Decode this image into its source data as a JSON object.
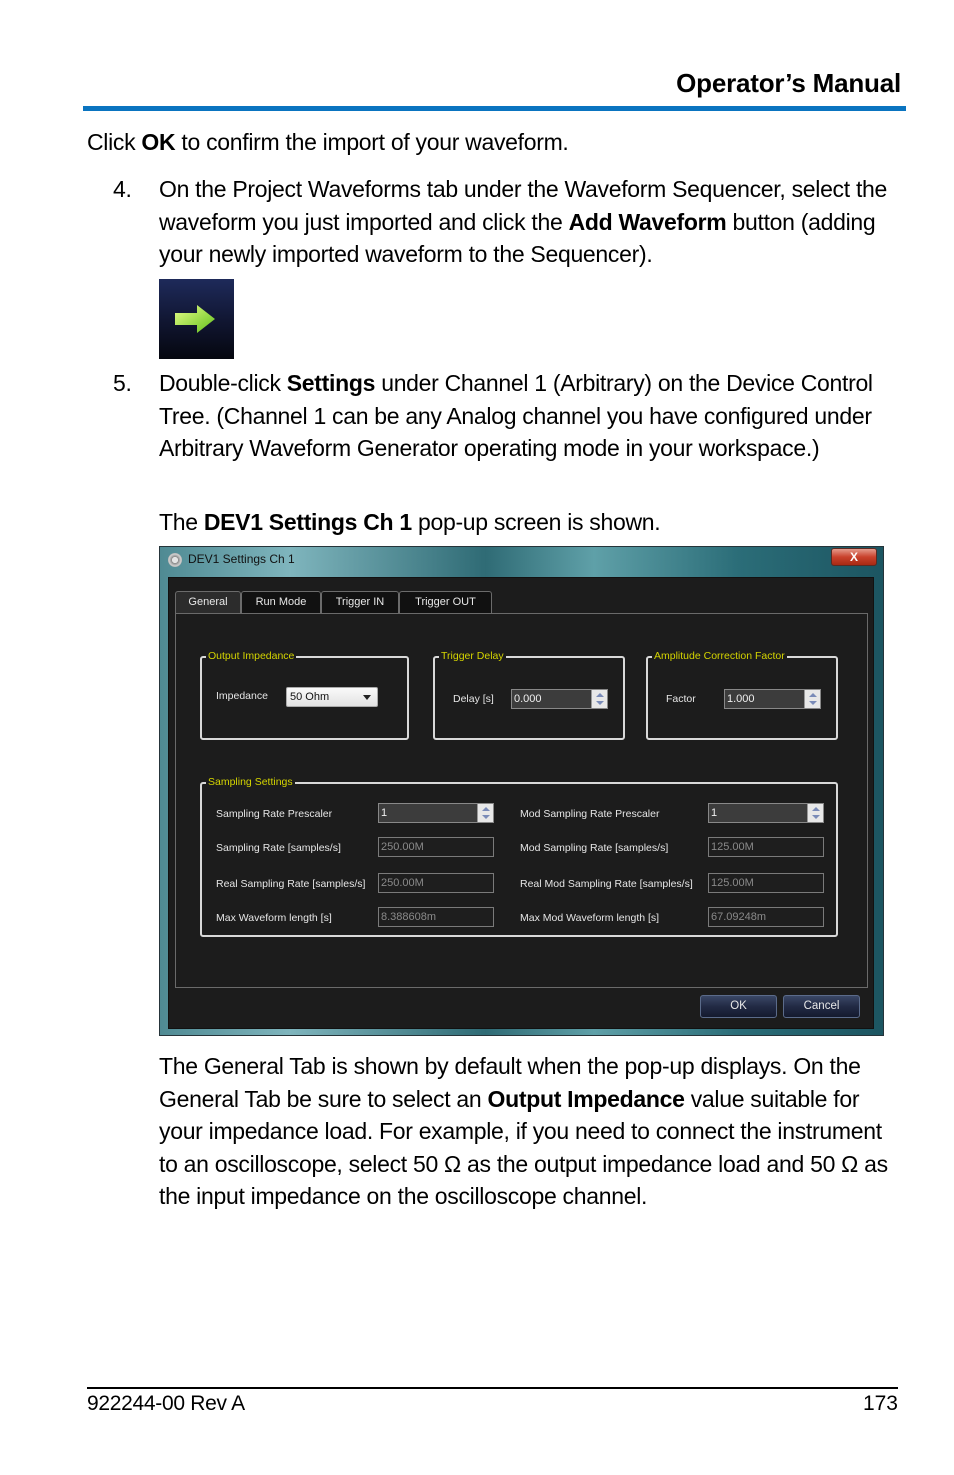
{
  "header": {
    "title": "Operator’s Manual",
    "accent_color": "#0a74c0"
  },
  "intro": {
    "pre": "Click ",
    "bold": "OK",
    "post": " to confirm the import of your waveform."
  },
  "steps": [
    {
      "number": "4.",
      "parts": [
        {
          "text": "On the Project Waveforms tab under the Waveform Sequencer, select the waveform you just imported and click the "
        },
        {
          "bold": "Add Waveform"
        },
        {
          "text": " button (adding your newly imported waveform to the Sequencer)."
        }
      ],
      "image_icon": "green-right-arrow-icon"
    },
    {
      "number": "5.",
      "parts": [
        {
          "text": "Double-click "
        },
        {
          "bold": "Settings"
        },
        {
          "text": " under Channel 1 (Arbitrary) on the Device Control Tree. (Channel 1 can be any Analog channel you have configured under Arbitrary Waveform Generator operating mode in your workspace.)"
        }
      ]
    }
  ],
  "popup_intro": {
    "pre": "The ",
    "bold": "DEV1 Settings Ch 1",
    "post": " pop-up screen is shown."
  },
  "dialog": {
    "title": "DEV1 Settings Ch 1",
    "close_label": "X",
    "tabs": [
      {
        "label": "General",
        "active": true
      },
      {
        "label": "Run Mode",
        "active": false
      },
      {
        "label": "Trigger IN",
        "active": false
      },
      {
        "label": "Trigger OUT",
        "active": false
      }
    ],
    "output_impedance": {
      "group_label": "Output Impedance",
      "field_label": "Impedance",
      "selected": "50 Ohm"
    },
    "trigger_delay": {
      "group_label": "Trigger Delay",
      "field_label": "Delay [s]",
      "value": "0.000"
    },
    "amplitude_correction": {
      "group_label": "Amplitude Correction Factor",
      "field_label": "Factor",
      "value": "1.000"
    },
    "sampling": {
      "group_label": "Sampling Settings",
      "left": [
        {
          "label": "Sampling Rate Prescaler",
          "value": "1",
          "type": "spin"
        },
        {
          "label": "Sampling Rate [samples/s]",
          "value": "250.00M",
          "type": "readonly"
        },
        {
          "label": "Real Sampling Rate [samples/s]",
          "value": "250.00M",
          "type": "readonly"
        },
        {
          "label": "Max Waveform length [s]",
          "value": "8.388608m",
          "type": "readonly"
        }
      ],
      "right": [
        {
          "label": "Mod Sampling Rate Prescaler",
          "value": "1",
          "type": "spin"
        },
        {
          "label": "Mod Sampling Rate [samples/s]",
          "value": "125.00M",
          "type": "readonly"
        },
        {
          "label": "Real Mod Sampling Rate [samples/s]",
          "value": "125.00M",
          "type": "readonly"
        },
        {
          "label": "Max Mod Waveform length [s]",
          "value": "67.09248m",
          "type": "readonly"
        }
      ]
    },
    "ok_label": "OK",
    "cancel_label": "Cancel"
  },
  "general_paragraph": {
    "parts": [
      {
        "text": "The General Tab is shown by default when the pop-up displays. On the General Tab be sure to select an "
      },
      {
        "bold": "Output Impedance"
      },
      {
        "text": " value suitable for your impedance load. For example, if you need to connect the instrument to an oscilloscope, select 50 Ω as the output impedance load and 50 Ω as the input impedance on the oscilloscope channel."
      }
    ]
  },
  "footer": {
    "doc_id": "922244-00 Rev A",
    "page_number": "173"
  }
}
